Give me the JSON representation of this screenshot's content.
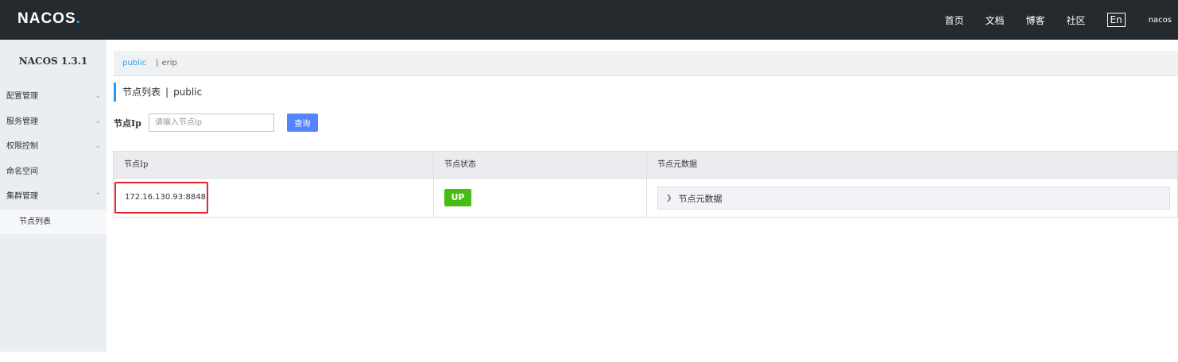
{
  "topbar": {
    "logo": "NACOS",
    "logo_dot": ".",
    "links": [
      "首页",
      "文档",
      "博客",
      "社区"
    ],
    "lang": "En",
    "user": "nacos"
  },
  "sidebar": {
    "title": "NACOS 1.3.1",
    "items": [
      {
        "label": "配置管理",
        "chevron": "v"
      },
      {
        "label": "服务管理",
        "chevron": "v"
      },
      {
        "label": "权限控制",
        "chevron": "v"
      },
      {
        "label": "命名空间"
      },
      {
        "label": "集群管理",
        "chevron": "^"
      }
    ],
    "sub_items": [
      {
        "label": "节点列表"
      }
    ]
  },
  "breadcrumb": {
    "active": "public",
    "separator": "|",
    "item": "erip"
  },
  "page_header": {
    "title": "节点列表",
    "separator": "|",
    "namespace": "public"
  },
  "search": {
    "label": "节点Ip",
    "placeholder": "请输入节点Ip",
    "button": "查询"
  },
  "table": {
    "columns": [
      "节点Ip",
      "节点状态",
      "节点元数据"
    ],
    "rows": [
      {
        "ip": "172.16.130.93:8848",
        "status": "UP",
        "metadata": "节点元数据"
      }
    ]
  },
  "colors": {
    "topbar": "#252a2f",
    "accent": "#209bfa",
    "button": "#5584ff",
    "status_up": "#46bc15",
    "highlight": "#e4232a"
  }
}
